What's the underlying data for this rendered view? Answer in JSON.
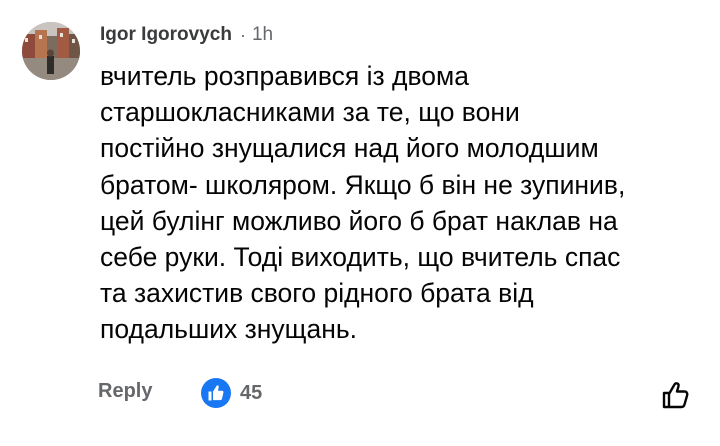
{
  "comment": {
    "author": "Igor Igorovych",
    "separator": "·",
    "time": "1h",
    "text": "вчитель розправився із двома\nстаршокласниками за те, що вони\nпостійно знущалися над його молодшим\nбратом- школяром. Якщо б він не зупинив,\nцей булінг можливо його б брат наклав на\nсебе руки. Тоді виходить, що вчитель спас\nта захистив свого рідного брата від\nподальших знущань."
  },
  "actions": {
    "reply_label": "Reply",
    "reaction_count": "45",
    "reaction_icon": "thumbs-up-icon",
    "like_icon": "thumbs-up-outline-icon"
  },
  "colors": {
    "text": "#050505",
    "secondary": "#65676b",
    "like_blue": "#1877f2"
  }
}
